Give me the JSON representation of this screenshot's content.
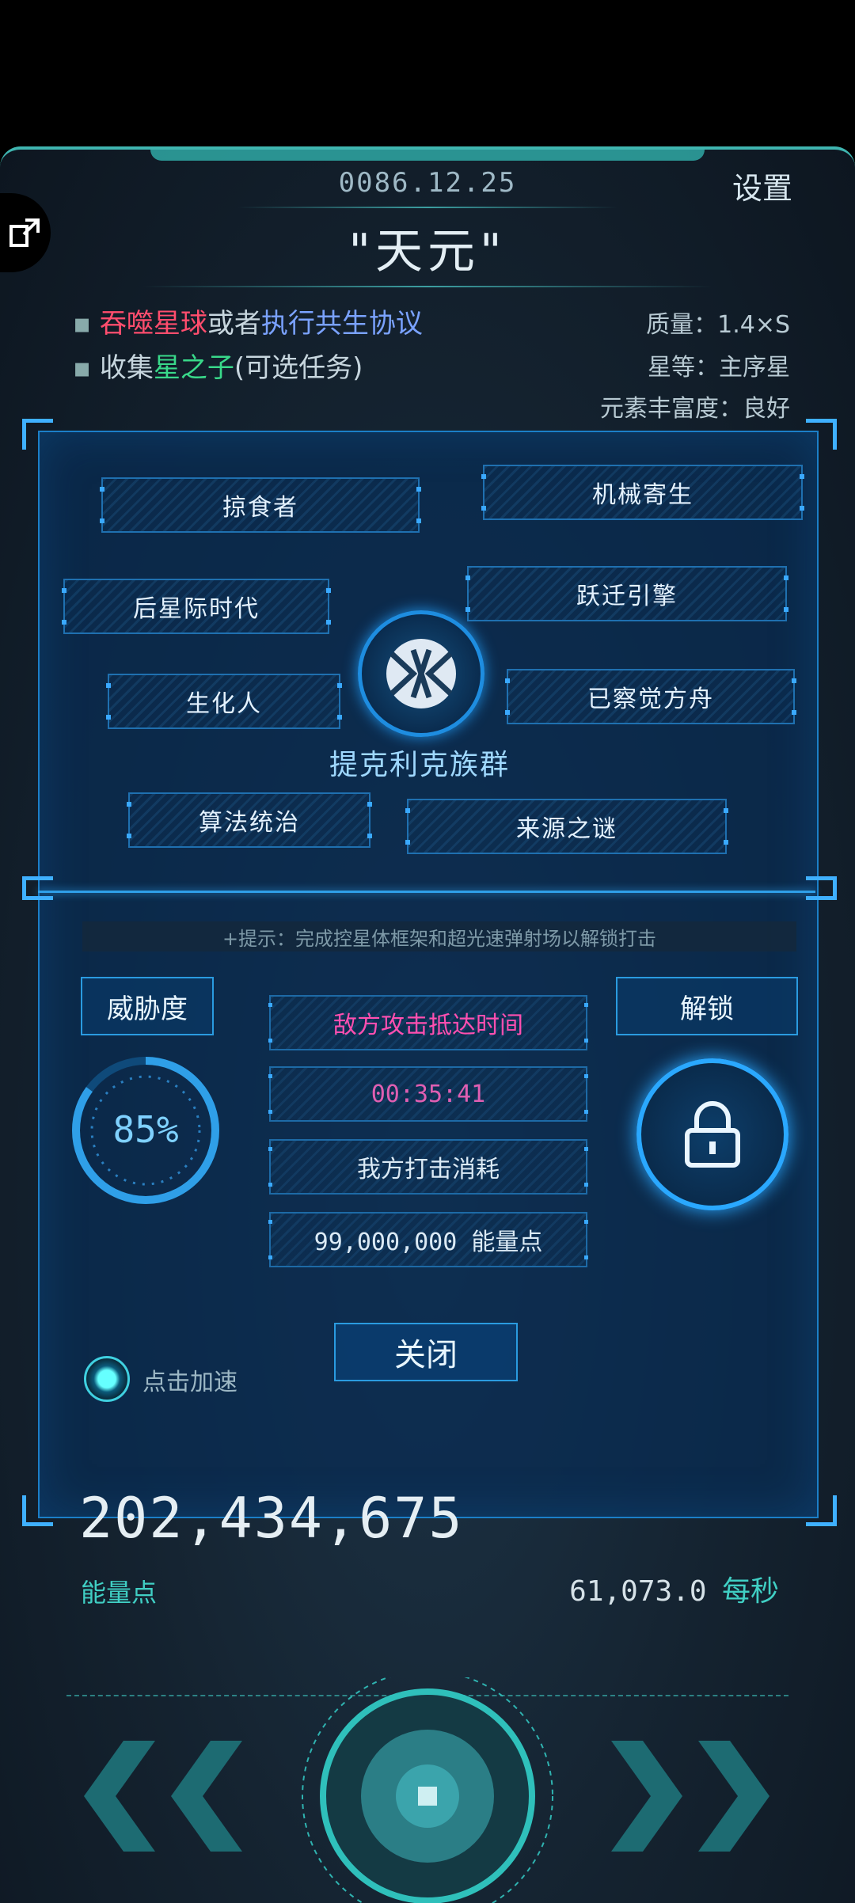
{
  "header": {
    "date": "0086.12.25",
    "settings_label": "设置",
    "title": "\"天元\""
  },
  "objectives": {
    "line1": {
      "part1": "吞噬星球",
      "part2": "或者",
      "part3": "执行共生协议"
    },
    "line2": {
      "part1": "收集",
      "part2": "星之子",
      "part3": "(可选任务)"
    }
  },
  "planet_stats": {
    "mass": "质量：1.4×S",
    "star_class": "星等：主序星",
    "element_richness": "元素丰富度：良好"
  },
  "traits": [
    "掠食者",
    "机械寄生",
    "后星际时代",
    "跃迁引擎",
    "生化人",
    "已察觉方舟",
    "算法统治",
    "来源之谜"
  ],
  "civilization_name": "提克利克族群",
  "hint": "+提示：完成控星体框架和超光速弹射场以解锁打击",
  "threat": {
    "label": "威胁度",
    "value": "85%",
    "level": 0.85
  },
  "attack": {
    "arrival_label": "敌方攻击抵达时间",
    "arrival_time": "00:35:41",
    "cost_label": "我方打击消耗",
    "cost_value": "99,000,000 能量点"
  },
  "unlock_label": "解锁",
  "close_label": "关闭",
  "accelerate_label": "点击加速",
  "energy": {
    "total": "202,434,675",
    "unit_label": "能量点",
    "rate": "61,073.0",
    "rate_unit": "每秒"
  },
  "colors": {
    "accent_cyan": "#3fd0c8",
    "panel_blue": "#1b7fc8",
    "red_text": "#ff4d6d",
    "blue_text": "#7aa2ff",
    "green_text": "#39d98a",
    "pink_text": "#ff4fb0"
  },
  "icons": {
    "exit": "exit-icon",
    "emblem": "alien-emblem-icon",
    "lock": "lock-icon",
    "prev": "double-chevron-left-icon",
    "next": "double-chevron-right-icon",
    "planet": "planet-core-icon"
  }
}
